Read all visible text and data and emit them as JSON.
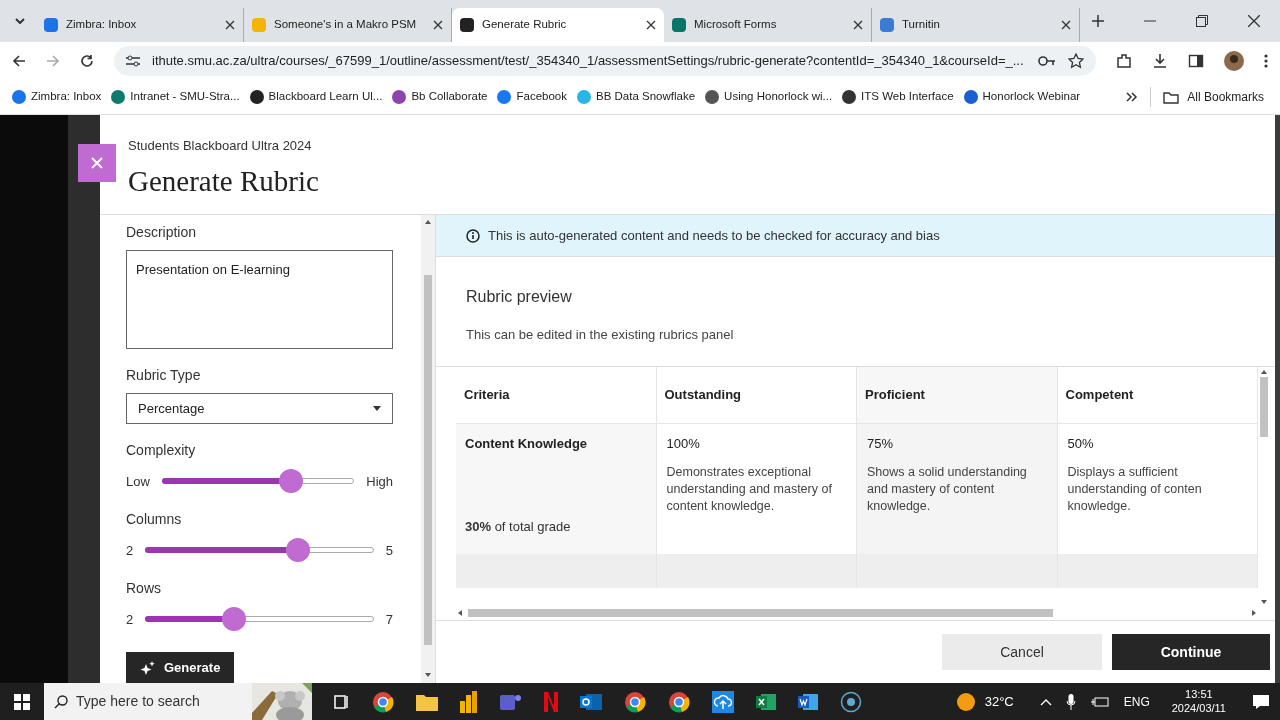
{
  "browser": {
    "tabs": [
      {
        "title": "Zimbra: Inbox",
        "selected": false,
        "color": "#1a73e8"
      },
      {
        "title": "Someone's in a Makro PSM",
        "selected": false,
        "color": "#f4b400"
      },
      {
        "title": "Generate Rubric",
        "selected": true,
        "color": "#222222"
      },
      {
        "title": "Microsoft Forms",
        "selected": false,
        "color": "#077568"
      },
      {
        "title": "Turnitin",
        "selected": false,
        "color": "#3a7bd5"
      }
    ],
    "address": "ithute.smu.ac.za/ultra/courses/_67599_1/outline/assessment/test/_354340_1/assessmentSettings/rubric-generate?contentId=_354340_1&courseId=_...",
    "bookmarks": [
      {
        "title": "Zimbra: Inbox",
        "color": "#1a73e8"
      },
      {
        "title": "Intranet - SMU-Stra...",
        "color": "#0f7b6c"
      },
      {
        "title": "Blackboard Learn Ul...",
        "color": "#222222"
      },
      {
        "title": "Bb Collaborate",
        "color": "#8e44ad"
      },
      {
        "title": "Facebook",
        "color": "#1877f2"
      },
      {
        "title": "BB Data Snowflake",
        "color": "#29b5e8"
      },
      {
        "title": "Using Honorlock wi...",
        "color": "#555555"
      },
      {
        "title": "ITS Web Interface",
        "color": "#333333"
      },
      {
        "title": "Honorlock Webinar",
        "color": "#1a5fd0"
      }
    ],
    "all_bookmarks": "All Bookmarks"
  },
  "modal": {
    "course": "Students Blackboard Ultra 2024",
    "title": "Generate Rubric",
    "description": {
      "label": "Description",
      "value": "Presentation on E-learning"
    },
    "rubric_type": {
      "label": "Rubric Type",
      "value": "Percentage"
    },
    "sliders": [
      {
        "label": "Complexity",
        "min": "Low",
        "max": "High",
        "level": 0.67
      },
      {
        "label": "Columns",
        "min": "2",
        "max": "5",
        "level": 0.67
      },
      {
        "label": "Rows",
        "min": "2",
        "max": "7",
        "level": 0.39
      }
    ],
    "generate_button": "Generate",
    "notice": "This is auto-generated content and needs to be checked for accuracy and bias",
    "preview_title": "Rubric preview",
    "preview_subtitle": "This can be edited in the existing rubrics panel",
    "table": {
      "columns": [
        "Criteria",
        "Outstanding",
        "Proficient",
        "Competent"
      ],
      "rows": [
        {
          "cells": [
            {
              "criterion": "Content Knowledge",
              "weight": "**30%** of total grade"
            },
            {
              "percent": "100%",
              "text": "Demonstrates exceptional understanding and mastery of content knowledge."
            },
            {
              "percent": "75%",
              "text": "Shows a solid understanding and mastery of content knowledge."
            },
            {
              "percent": "50%",
              "text": "Displays a sufficient understanding of conten knowledge."
            }
          ]
        }
      ]
    },
    "cancel": "Cancel",
    "continue": "Continue"
  },
  "taskbar": {
    "search_placeholder": "Type here to search",
    "temperature": "32°C",
    "language": "ENG",
    "time": "13:51",
    "date": "2024/03/11"
  }
}
